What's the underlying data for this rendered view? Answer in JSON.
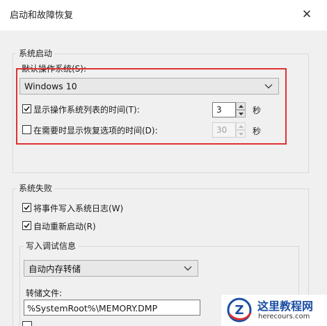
{
  "window": {
    "title": "启动和故障恢复",
    "close_symbol": "✕"
  },
  "system_startup": {
    "legend": "系统启动",
    "default_os_label": "默认操作系统(S):",
    "default_os_value": "Windows 10",
    "show_os_list": {
      "label": "显示操作系统列表的时间(T):",
      "checked": true,
      "value": "3",
      "unit": "秒"
    },
    "show_recovery": {
      "label": "在需要时显示恢复选项的时间(D):",
      "checked": false,
      "value": "30",
      "unit": "秒"
    }
  },
  "system_failure": {
    "legend": "系统失败",
    "write_event_log": {
      "label": "将事件写入系统日志(W)",
      "checked": true
    },
    "auto_restart": {
      "label": "自动重新启动(R)",
      "checked": true
    },
    "debug_info": {
      "legend": "写入调试信息",
      "dump_type": "自动内存转储",
      "dump_file_label": "转储文件:",
      "dump_file_value": "%SystemRoot%\\MEMORY.DMP"
    }
  },
  "watermark": {
    "title": "这里教程网",
    "url": "herecours.com"
  },
  "colors": {
    "highlight": "#e03030",
    "panel": "#f0f0f0",
    "brand": "#1b4ea3"
  }
}
